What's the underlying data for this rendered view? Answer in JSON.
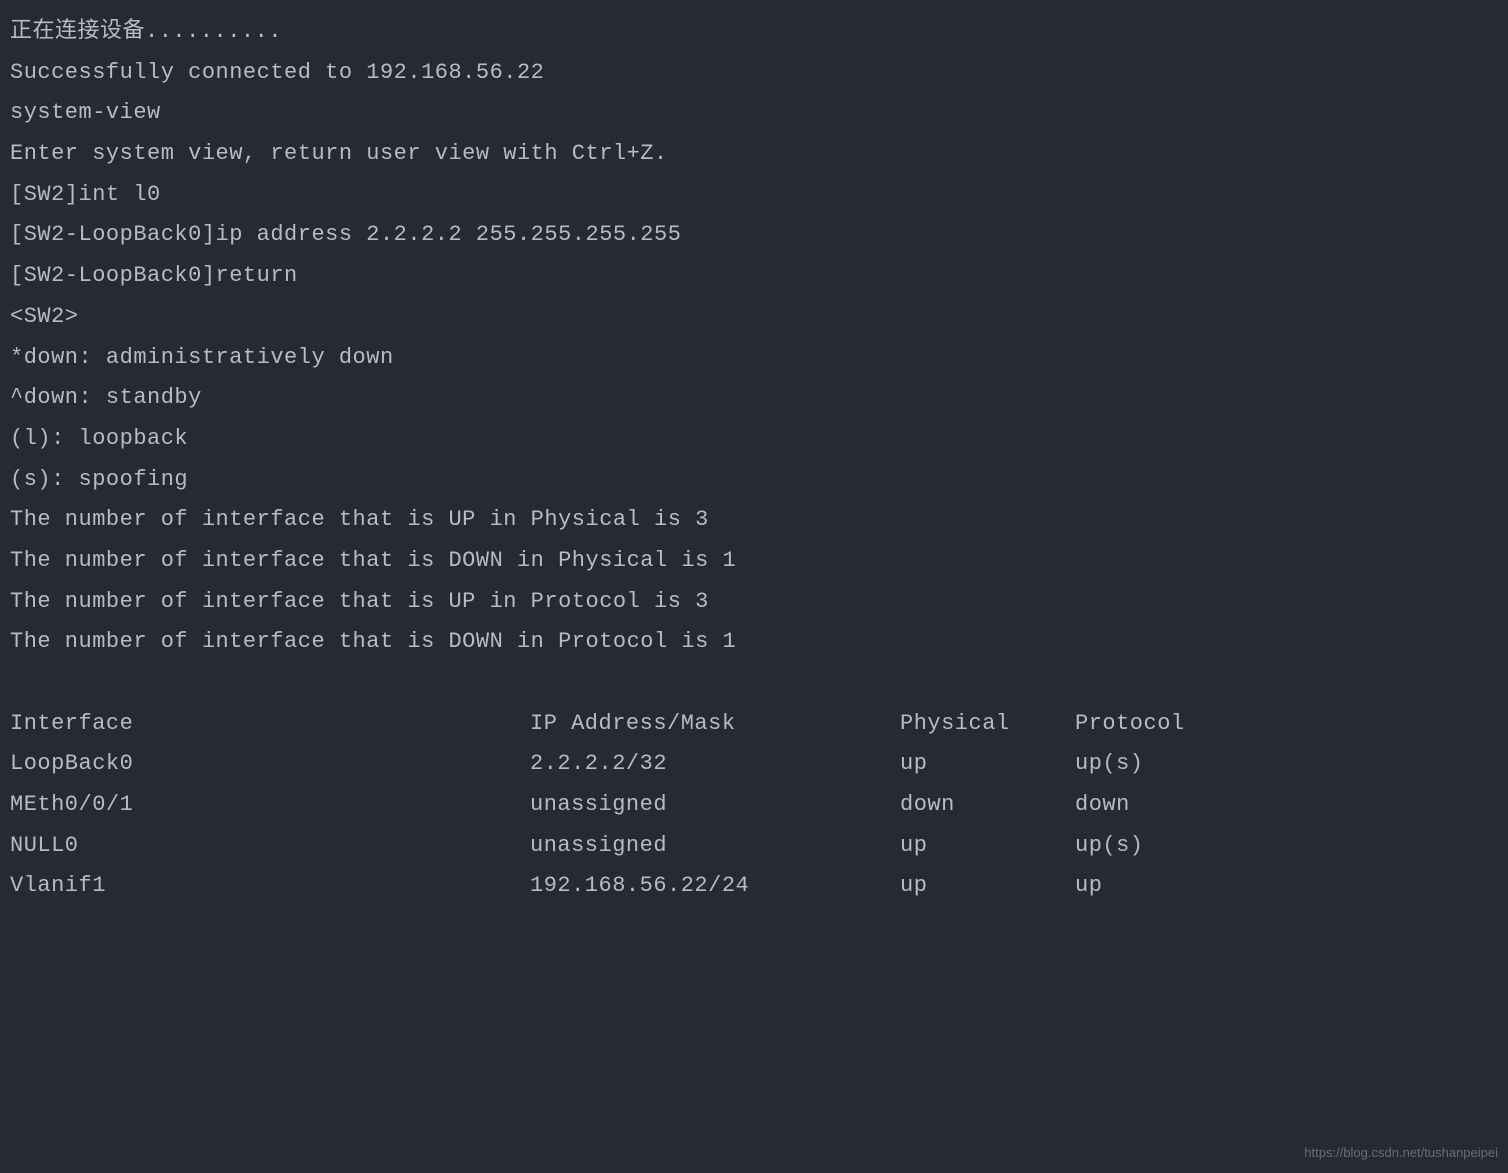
{
  "lines": {
    "connecting": "正在连接设备..........",
    "connected": "Successfully connected to 192.168.56.22",
    "system_view": "system-view",
    "enter_view": "Enter system view, return user view with Ctrl+Z.",
    "int_l0": "[SW2]int l0",
    "ip_address": "[SW2-LoopBack0]ip address 2.2.2.2 255.255.255.255",
    "return": "[SW2-LoopBack0]return",
    "prompt": "<SW2>",
    "admin_down": "*down: administratively down",
    "standby": "^down: standby",
    "loopback": "(l): loopback",
    "spoofing": "(s): spoofing",
    "up_physical": "The number of interface that is UP in Physical is 3",
    "down_physical": "The number of interface that is DOWN in Physical is 1",
    "up_protocol": "The number of interface that is UP in Protocol is 3",
    "down_protocol": "The number of interface that is DOWN in Protocol is 1"
  },
  "table": {
    "header": {
      "interface": "Interface",
      "ip": "IP Address/Mask",
      "physical": "Physical",
      "protocol": "Protocol"
    },
    "rows": [
      {
        "interface": "LoopBack0",
        "ip": "2.2.2.2/32",
        "physical": "up",
        "protocol": "up(s)"
      },
      {
        "interface": "MEth0/0/1",
        "ip": "unassigned",
        "physical": "down",
        "protocol": "down"
      },
      {
        "interface": "NULL0",
        "ip": "unassigned",
        "physical": "up",
        "protocol": "up(s)"
      },
      {
        "interface": "Vlanif1",
        "ip": "192.168.56.22/24",
        "physical": "up",
        "protocol": "up"
      }
    ]
  },
  "watermark": "https://blog.csdn.net/tushanpeipei"
}
